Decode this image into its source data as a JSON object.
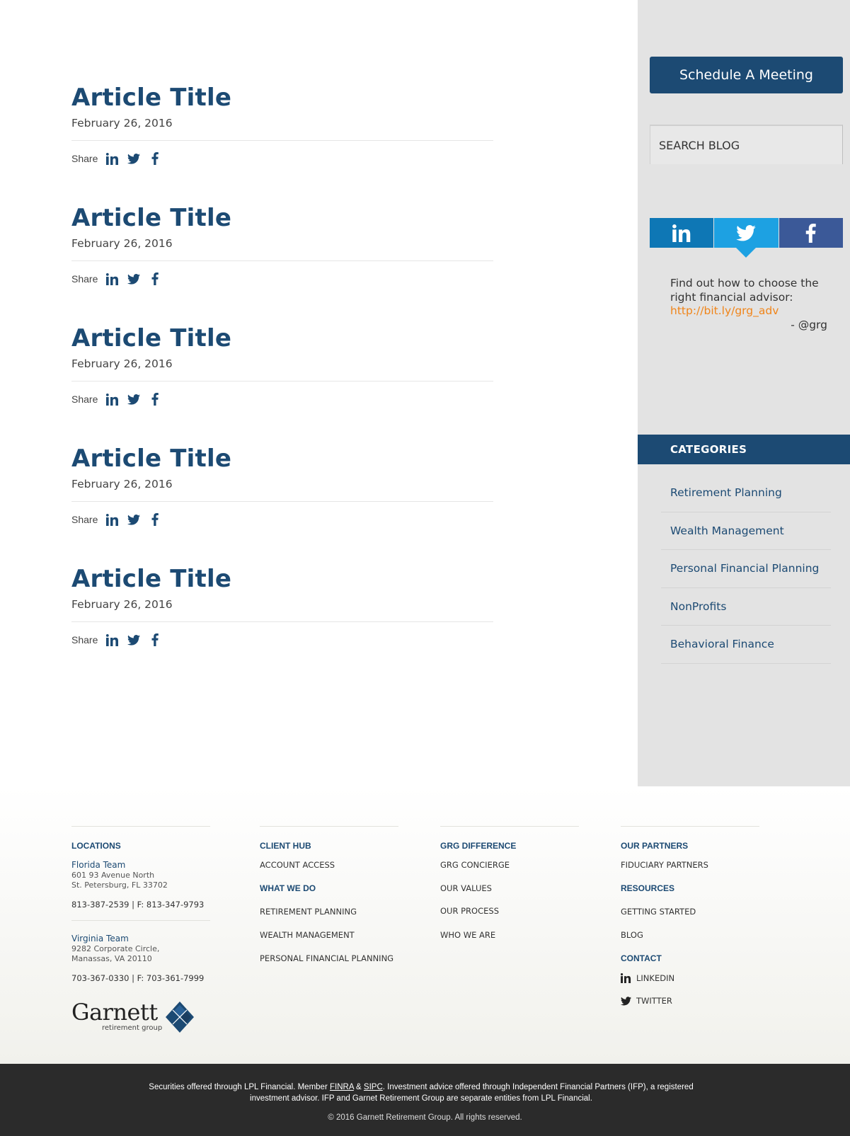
{
  "articles": [
    {
      "title": "Article Title",
      "date": "February 26, 2016",
      "share_label": "Share"
    },
    {
      "title": "Article Title",
      "date": "February 26, 2016",
      "share_label": "Share"
    },
    {
      "title": "Article Title",
      "date": "February 26, 2016",
      "share_label": "Share"
    },
    {
      "title": "Article Title",
      "date": "February 26, 2016",
      "share_label": "Share"
    },
    {
      "title": "Article Title",
      "date": "February 26, 2016",
      "share_label": "Share"
    }
  ],
  "share_icons": [
    "linkedin-icon",
    "twitter-icon",
    "facebook-icon"
  ],
  "sidebar": {
    "meeting_button": "Schedule A Meeting",
    "search_placeholder": "SEARCH BLOG",
    "social_tabs": [
      "linkedin",
      "twitter",
      "facebook"
    ],
    "tweet": {
      "text": "Find out how to choose the right financial advisor:",
      "link": "http://bit.ly/grg_adv",
      "author": "- @grg"
    },
    "categories_title": "CATEGORIES",
    "categories": [
      "Retirement Planning",
      "Wealth Management",
      "Personal Financial Planning",
      "NonProfits",
      "Behavioral Finance"
    ]
  },
  "footer": {
    "locations": {
      "heading": "LOCATIONS",
      "florida": {
        "name": "Florida Team",
        "address_line1": "601 93 Avenue North",
        "address_line2": "St. Petersburg, FL 33702",
        "phone": "813-387-2539 | F: 813-347-9793"
      },
      "virginia": {
        "name": "Virginia Team",
        "address_line1": "9282 Corporate Circle,",
        "address_line2": "Manassas, VA 20110",
        "phone": "703-367-0330 | F: 703-361-7999"
      },
      "logo_word": "Garnett",
      "logo_sub": "retirement group"
    },
    "client_hub": {
      "heading": "CLIENT HUB",
      "links": [
        "ACCOUNT ACCESS"
      ]
    },
    "what_we_do": {
      "heading": "WHAT WE DO",
      "links": [
        "RETIREMENT PLANNING",
        "WEALTH MANAGEMENT",
        "PERSONAL FINANCIAL PLANNING"
      ]
    },
    "grg_difference": {
      "heading": "GRG DIFFERENCE",
      "links": [
        "GRG CONCIERGE",
        "OUR VALUES",
        "OUR PROCESS",
        "WHO WE ARE"
      ]
    },
    "our_partners": {
      "heading": "OUR PARTNERS",
      "links": [
        "FIDUCIARY PARTNERS"
      ]
    },
    "resources": {
      "heading": "RESOURCES",
      "links": [
        "GETTING STARTED",
        "BLOG"
      ]
    },
    "contact": {
      "heading": "CONTACT",
      "links": [
        "LINKEDIN",
        "TWITTER"
      ]
    }
  },
  "legal": {
    "part1": "Securities offered through LPL Financial. Member ",
    "finra": "FINRA",
    "amp": " & ",
    "sipc": "SIPC",
    "part2": ". Investment advice offered through Independent Financial Partners (IFP), a registered investment advisor.  IFP and Garnet Retirement Group are separate entities from LPL Financial.",
    "copyright": "© 2016 Garnett Retirement Group. All rights reserved."
  },
  "colors": {
    "brand": "#1c4a73",
    "linkedin": "#0e77b5",
    "twitter": "#1da1e2",
    "facebook": "#3b5998",
    "tweet_link": "#f0851a"
  }
}
